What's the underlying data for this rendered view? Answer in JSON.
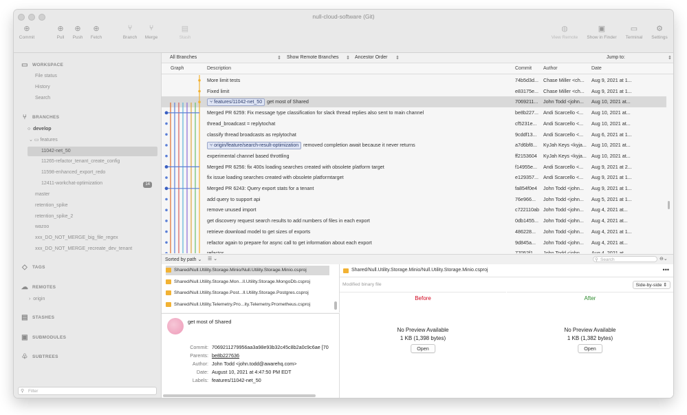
{
  "window": {
    "title": "null-cloud-software (Git)"
  },
  "toolbar": {
    "left": [
      {
        "label": "Commit",
        "icon": "commit-icon"
      },
      {
        "label": "Pull",
        "icon": "pull-icon"
      },
      {
        "label": "Push",
        "icon": "push-icon"
      },
      {
        "label": "Fetch",
        "icon": "fetch-icon"
      },
      {
        "label": "Branch",
        "icon": "branch-icon"
      },
      {
        "label": "Merge",
        "icon": "merge-icon"
      },
      {
        "label": "Stash",
        "icon": "stash-icon"
      }
    ],
    "right": [
      {
        "label": "View Remote",
        "icon": "globe-icon"
      },
      {
        "label": "Show in Finder",
        "icon": "finder-icon"
      },
      {
        "label": "Terminal",
        "icon": "terminal-icon"
      },
      {
        "label": "Settings",
        "icon": "gear-icon"
      }
    ]
  },
  "sidebar": {
    "workspace": {
      "title": "WORKSPACE",
      "items": [
        "File status",
        "History",
        "Search"
      ]
    },
    "branches": {
      "title": "BRANCHES",
      "current": "develop",
      "folder": "features",
      "feature_items": [
        {
          "label": "11042-net_50",
          "selected": true
        },
        {
          "label": "11265-refactor_tenant_create_config"
        },
        {
          "label": "11598-enhanced_export_redo"
        },
        {
          "label": "12411-workchat-optimization",
          "badge": "14"
        }
      ],
      "items": [
        "master",
        "retention_spike",
        "retention_spike_2",
        "wazoo",
        "xxx_DO_NOT_MERGE_big_file_regex",
        "xxx_DO_NOT_MERGE_recreate_dev_tenant"
      ]
    },
    "tags": {
      "title": "TAGS"
    },
    "remotes": {
      "title": "REMOTES",
      "items": [
        "origin"
      ]
    },
    "stashes": {
      "title": "STASHES"
    },
    "submodules": {
      "title": "SUBMODULES"
    },
    "subtrees": {
      "title": "SUBTREES"
    },
    "filter_placeholder": "Filter"
  },
  "history_toolbar": {
    "branches": "All Branches",
    "remote": "Show Remote Branches",
    "order": "Ancestor Order",
    "jump": "Jump to:"
  },
  "columns": {
    "graph": "Graph",
    "description": "Description",
    "commit": "Commit",
    "author": "Author",
    "date": "Date"
  },
  "commits": [
    {
      "description": "More limit tests",
      "commit": "74b5d3d...",
      "author": "Chase Miller <ch...",
      "date": "Aug 9, 2021 at 1..."
    },
    {
      "description": "Fixed limit",
      "commit": "e83175e...",
      "author": "Chase Miller <ch...",
      "date": "Aug 9, 2021 at 1..."
    },
    {
      "tag": "features/11042-net_50",
      "description": "get most of Shared",
      "commit": "7069211...",
      "author": "John Todd <john...",
      "date": "Aug 10, 2021 at...",
      "selected": true
    },
    {
      "description": "Merged PR 6259: Fix message type classification for slack thread replies also sent to main channel",
      "commit": "be8b227...",
      "author": "Andi Scarcello <...",
      "date": "Aug 10, 2021 at..."
    },
    {
      "description": "thread_broadcast = replytochat",
      "commit": "cf5231e...",
      "author": "Andi Scarcello <...",
      "date": "Aug 10, 2021 at..."
    },
    {
      "description": "classify thread broadcasts as replytochat",
      "commit": "9cddf13...",
      "author": "Andi Scarcello <...",
      "date": "Aug 6, 2021 at 1..."
    },
    {
      "tag": "origin/feature/search-result-optimization",
      "description": "removed completion await because it never returns",
      "commit": "a7d6bf8...",
      "author": "KyJah Keys <kyja...",
      "date": "Aug 10, 2021 at..."
    },
    {
      "description": "experimental channel based throttling",
      "commit": "ff2153604",
      "author": "KyJah Keys <kyja...",
      "date": "Aug 10, 2021 at..."
    },
    {
      "description": "Merged PR 6256: fix 400s loading searches created with obsolete platform target",
      "commit": "f14955e...",
      "author": "Andi Scarcello <...",
      "date": "Aug 9, 2021 at 2..."
    },
    {
      "description": "fix issue loading searches created with obsolete platformtarget",
      "commit": "e129357...",
      "author": "Andi Scarcello <...",
      "date": "Aug 9, 2021 at 1..."
    },
    {
      "description": "Merged PR 6243: Query export stats for a tenant",
      "commit": "fa854f0e4",
      "author": "John Todd <john...",
      "date": "Aug 9, 2021 at 1..."
    },
    {
      "description": "add query to support api",
      "commit": "76e966...",
      "author": "John Todd <john...",
      "date": "Aug 5, 2021 at 1..."
    },
    {
      "description": "remove unused import",
      "commit": "c722110ab",
      "author": "John Todd <john...",
      "date": "Aug 4, 2021 at..."
    },
    {
      "description": "get discovery request search results to add numbers of files in each export",
      "commit": "0db1455...",
      "author": "John Todd <john...",
      "date": "Aug 4, 2021 at..."
    },
    {
      "description": "retrieve download model to get sizes of exports",
      "commit": "486228...",
      "author": "John Todd <john...",
      "date": "Aug 4, 2021 at 1..."
    },
    {
      "description": "refactor again to prepare for async call to get information about each export",
      "commit": "9d845a...",
      "author": "John Todd <john...",
      "date": "Aug 4, 2021 at..."
    },
    {
      "description": "refactor",
      "commit": "77052f1...",
      "author": "John Todd <john...",
      "date": "Aug 4, 2021 at..."
    }
  ],
  "files_bar": {
    "sort": "Sorted by path",
    "search_placeholder": "Search"
  },
  "files": [
    {
      "path": "Shared/Null.Utility.Storage.Minio/Null.Utility.Storage.Minio.csproj",
      "selected": true
    },
    {
      "path": "Shared/Null.Utility.Storage.Mon...ll.Utility.Storage.MongoDb.csproj"
    },
    {
      "path": "Shared/Null.Utility.Storage.Post...ll.Utility.Storage.Postgres.csproj"
    },
    {
      "path": "Shared/Null.Utility.Telemetry.Pro...ity.Telemetry.Prometheus.csproj"
    }
  ],
  "commit_info": {
    "message": "get most of Shared",
    "labels": {
      "commit": "Commit:",
      "parents": "Parents:",
      "author": "Author:",
      "date": "Date:",
      "labels": "Labels:"
    },
    "commit": "7069211279956aa3a98e93b32c45c8b2a0c9c6ae [70",
    "parents": "be8b227636",
    "author": "John Todd <john.todd@awarehq.com>",
    "date": "August 10, 2021 at 4:47:50 PM EDT",
    "label_value": "features/11042-net_50"
  },
  "preview": {
    "file": "Shared/Null.Utility.Storage.Minio/Null.Utility.Storage.Minio.csproj",
    "subtitle": "Modified binary file",
    "mode": "Side-by-side",
    "before": {
      "title": "Before",
      "message": "No Preview Available",
      "size": "1 KB (1,398 bytes)",
      "button": "Open"
    },
    "after": {
      "title": "After",
      "message": "No Preview Available",
      "size": "1 KB (1,382 bytes)",
      "button": "Open"
    }
  },
  "colors": {
    "before": "#d0021b",
    "after": "#2e8b2e",
    "tag_bg": "#dfe5f5",
    "selection": "#d9d9d9"
  }
}
